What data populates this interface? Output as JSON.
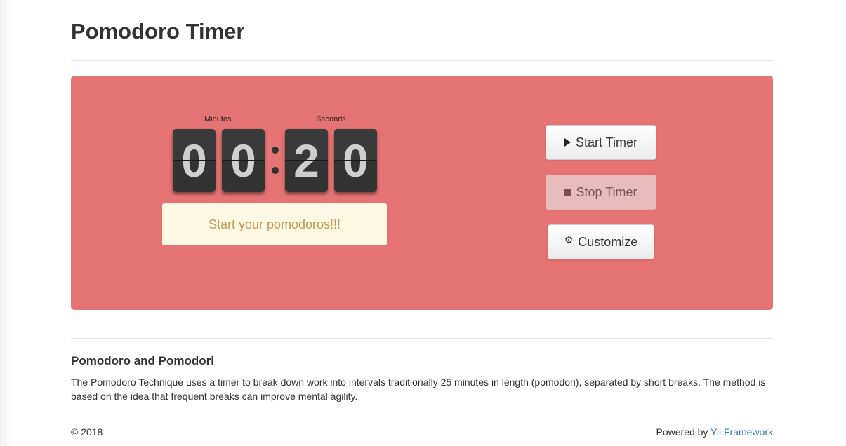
{
  "page": {
    "title": "Pomodoro Timer"
  },
  "timer": {
    "minutes_label": "Minutes",
    "seconds_label": "Seconds",
    "digits": [
      "0",
      "0",
      "2",
      "0"
    ],
    "message": "Start your pomodoros!!!",
    "panel_color": "#e57373"
  },
  "controls": {
    "start_label": "Start Timer",
    "stop_label": "Stop Timer",
    "customize_label": "Customize",
    "icons": [
      "play-icon",
      "stop-icon",
      "cog-icon"
    ]
  },
  "about": {
    "heading": "Pomodoro and Pomodori",
    "text": "The Pomodoro Technique uses a timer to break down work into intervals traditionally 25 minutes in length (pomodori), separated by short breaks. The method is based on the idea that frequent breaks can improve mental agility."
  },
  "footer": {
    "copyright": "© 2018",
    "powered_prefix": "Powered by ",
    "powered_link": "Yii Framework"
  }
}
